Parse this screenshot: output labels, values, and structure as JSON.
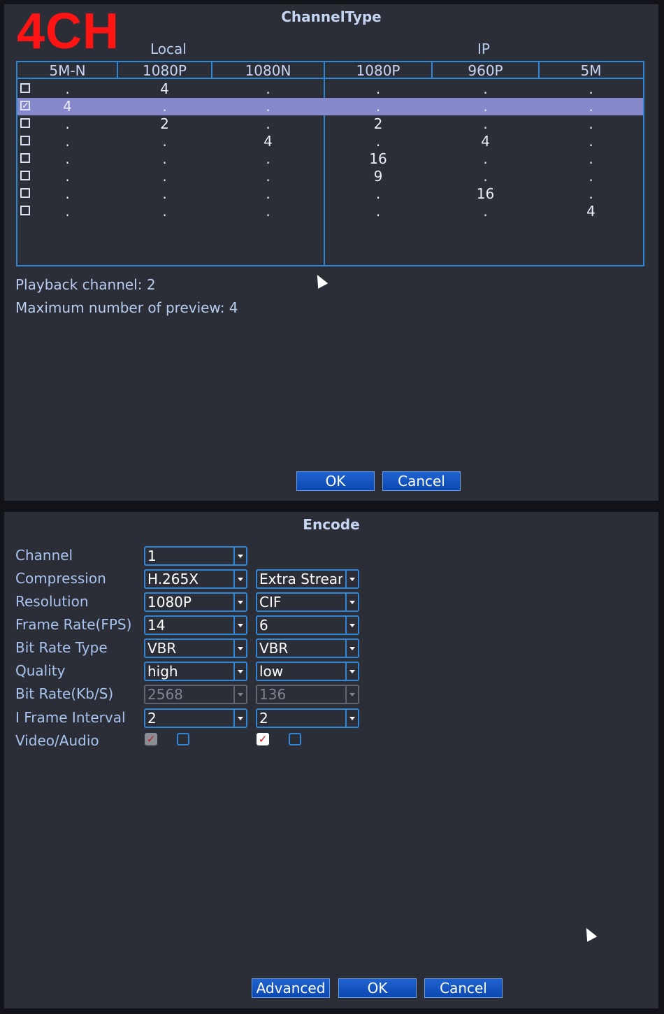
{
  "brand": "4CH",
  "channel_type": {
    "title": "ChannelType",
    "group_local": "Local",
    "group_ip": "IP",
    "columns": [
      "5M-N",
      "1080P",
      "1080N",
      "1080P",
      "960P",
      "5M"
    ],
    "rows": [
      {
        "checked": false,
        "cells": [
          ".",
          "4",
          ".",
          ".",
          ".",
          "."
        ]
      },
      {
        "checked": true,
        "cells": [
          "4",
          ".",
          ".",
          ".",
          ".",
          "."
        ]
      },
      {
        "checked": false,
        "cells": [
          ".",
          "2",
          ".",
          "2",
          ".",
          "."
        ]
      },
      {
        "checked": false,
        "cells": [
          ".",
          ".",
          "4",
          ".",
          "4",
          "."
        ]
      },
      {
        "checked": false,
        "cells": [
          ".",
          ".",
          ".",
          "16",
          ".",
          "."
        ]
      },
      {
        "checked": false,
        "cells": [
          ".",
          ".",
          ".",
          "9",
          ".",
          "."
        ]
      },
      {
        "checked": false,
        "cells": [
          ".",
          ".",
          ".",
          ".",
          "16",
          "."
        ]
      },
      {
        "checked": false,
        "cells": [
          ".",
          ".",
          ".",
          ".",
          ".",
          "4"
        ]
      }
    ],
    "playback_channel": "Playback channel: 2",
    "max_preview": "Maximum number of preview: 4",
    "ok_label": "OK",
    "cancel_label": "Cancel"
  },
  "encode": {
    "title": "Encode",
    "labels": {
      "channel": "Channel",
      "compression": "Compression",
      "resolution": "Resolution",
      "frame_rate": "Frame Rate(FPS)",
      "bit_rate_type": "Bit Rate Type",
      "quality": "Quality",
      "bit_rate": "Bit Rate(Kb/S)",
      "i_frame": "I Frame Interval",
      "video_audio": "Video/Audio"
    },
    "channel": "1",
    "main": {
      "compression": "H.265X",
      "resolution": "1080P",
      "frame_rate": "14",
      "bit_rate_type": "VBR",
      "quality": "high",
      "bit_rate": "2568",
      "i_frame": " 2",
      "video": true,
      "audio": false
    },
    "extra": {
      "stream": "Extra Stream",
      "resolution": "CIF",
      "frame_rate": "6",
      "bit_rate_type": "VBR",
      "quality": "low",
      "bit_rate": "136",
      "i_frame": " 2",
      "video": true,
      "audio": false
    },
    "advanced_label": "Advanced",
    "ok_label": "OK",
    "cancel_label": "Cancel"
  }
}
